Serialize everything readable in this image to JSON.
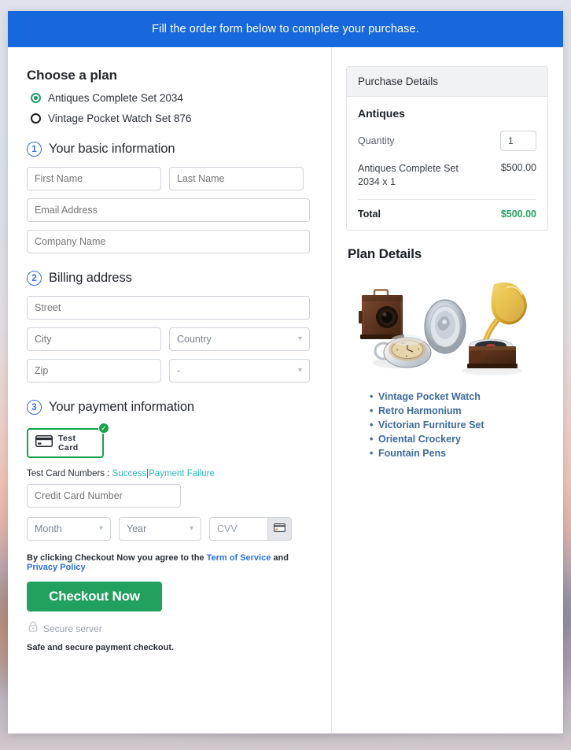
{
  "banner": {
    "text": "Fill the order form below to complete your purchase."
  },
  "plan_chooser": {
    "title": "Choose a plan",
    "options": [
      {
        "label": "Antiques Complete Set 2034",
        "selected": true
      },
      {
        "label": "Vintage Pocket Watch Set 876",
        "selected": false
      }
    ]
  },
  "steps": {
    "basic": {
      "number": "1",
      "label": "Your basic information"
    },
    "billing": {
      "number": "2",
      "label": "Billing address"
    },
    "payment": {
      "number": "3",
      "label": "Your payment information"
    }
  },
  "basic_fields": {
    "first_name": {
      "value": "",
      "placeholder": "First Name"
    },
    "last_name": {
      "value": "",
      "placeholder": "Last Name"
    },
    "email": {
      "value": "",
      "placeholder": "Email Address"
    },
    "company": {
      "value": "",
      "placeholder": "Company Name"
    }
  },
  "billing_fields": {
    "street": {
      "value": "",
      "placeholder": "Street"
    },
    "city": {
      "value": "",
      "placeholder": "City"
    },
    "country": {
      "value": "Country"
    },
    "zip": {
      "value": "",
      "placeholder": "Zip"
    },
    "state": {
      "value": "-"
    }
  },
  "payment": {
    "test_card_tile_label": "Test Card",
    "card_icon": "credit-card-icon",
    "selected_badge": "check-circle-icon",
    "test_numbers_label": "Test Card Numbers :",
    "success_link": "Success",
    "separator": "|",
    "failure_link": "Payment Failure",
    "card_number": {
      "value": "",
      "placeholder": "Credit Card Number"
    },
    "month": {
      "value": "Month"
    },
    "year": {
      "value": "Year"
    },
    "cvv": {
      "value": "",
      "placeholder": "CVV"
    },
    "cvv_icon": "credit-card-icon"
  },
  "terms": {
    "prefix": "By clicking Checkout Now you agree to the",
    "tos_link": "Term of Service",
    "and": "and",
    "privacy_link": "Privacy Policy"
  },
  "checkout": {
    "button_label": "Checkout Now",
    "lock_icon": "lock-icon",
    "secure_label": "Secure server",
    "safe_note": "Safe and secure payment checkout."
  },
  "purchase_details": {
    "header": "Purchase Details",
    "product_name": "Antiques",
    "quantity_label": "Quantity",
    "quantity_value": "1",
    "line_item_desc": "Antiques Complete Set 2034 x 1",
    "line_item_amount": "$500.00",
    "total_label": "Total",
    "total_amount": "$500.00"
  },
  "plan_details": {
    "title": "Plan Details",
    "image_alt": "antique-items-image",
    "features": [
      "Vintage Pocket Watch",
      "Retro Harmonium",
      "Victorian Furniture Set",
      "Oriental Crockery",
      "Fountain Pens"
    ]
  },
  "colors": {
    "banner_blue": "#1767dd",
    "accent_green": "#22a05e",
    "radio_green": "#1f9d6b",
    "link_blue": "#2f6fe0",
    "link_cyan": "#2bb8c4",
    "step_blue": "#3f73d8",
    "feature_blue": "#3d6ba0"
  }
}
